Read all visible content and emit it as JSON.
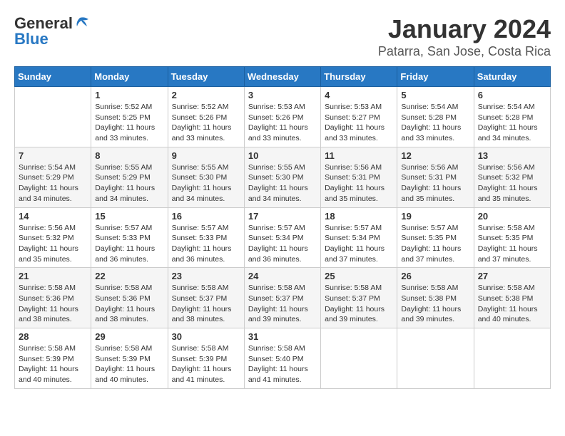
{
  "logo": {
    "line1": "General",
    "line2": "Blue"
  },
  "title": "January 2024",
  "subtitle": "Patarra, San Jose, Costa Rica",
  "headers": [
    "Sunday",
    "Monday",
    "Tuesday",
    "Wednesday",
    "Thursday",
    "Friday",
    "Saturday"
  ],
  "weeks": [
    [
      {
        "num": "",
        "info": ""
      },
      {
        "num": "1",
        "info": "Sunrise: 5:52 AM\nSunset: 5:25 PM\nDaylight: 11 hours\nand 33 minutes."
      },
      {
        "num": "2",
        "info": "Sunrise: 5:52 AM\nSunset: 5:26 PM\nDaylight: 11 hours\nand 33 minutes."
      },
      {
        "num": "3",
        "info": "Sunrise: 5:53 AM\nSunset: 5:26 PM\nDaylight: 11 hours\nand 33 minutes."
      },
      {
        "num": "4",
        "info": "Sunrise: 5:53 AM\nSunset: 5:27 PM\nDaylight: 11 hours\nand 33 minutes."
      },
      {
        "num": "5",
        "info": "Sunrise: 5:54 AM\nSunset: 5:28 PM\nDaylight: 11 hours\nand 33 minutes."
      },
      {
        "num": "6",
        "info": "Sunrise: 5:54 AM\nSunset: 5:28 PM\nDaylight: 11 hours\nand 34 minutes."
      }
    ],
    [
      {
        "num": "7",
        "info": "Sunrise: 5:54 AM\nSunset: 5:29 PM\nDaylight: 11 hours\nand 34 minutes."
      },
      {
        "num": "8",
        "info": "Sunrise: 5:55 AM\nSunset: 5:29 PM\nDaylight: 11 hours\nand 34 minutes."
      },
      {
        "num": "9",
        "info": "Sunrise: 5:55 AM\nSunset: 5:30 PM\nDaylight: 11 hours\nand 34 minutes."
      },
      {
        "num": "10",
        "info": "Sunrise: 5:55 AM\nSunset: 5:30 PM\nDaylight: 11 hours\nand 34 minutes."
      },
      {
        "num": "11",
        "info": "Sunrise: 5:56 AM\nSunset: 5:31 PM\nDaylight: 11 hours\nand 35 minutes."
      },
      {
        "num": "12",
        "info": "Sunrise: 5:56 AM\nSunset: 5:31 PM\nDaylight: 11 hours\nand 35 minutes."
      },
      {
        "num": "13",
        "info": "Sunrise: 5:56 AM\nSunset: 5:32 PM\nDaylight: 11 hours\nand 35 minutes."
      }
    ],
    [
      {
        "num": "14",
        "info": "Sunrise: 5:56 AM\nSunset: 5:32 PM\nDaylight: 11 hours\nand 35 minutes."
      },
      {
        "num": "15",
        "info": "Sunrise: 5:57 AM\nSunset: 5:33 PM\nDaylight: 11 hours\nand 36 minutes."
      },
      {
        "num": "16",
        "info": "Sunrise: 5:57 AM\nSunset: 5:33 PM\nDaylight: 11 hours\nand 36 minutes."
      },
      {
        "num": "17",
        "info": "Sunrise: 5:57 AM\nSunset: 5:34 PM\nDaylight: 11 hours\nand 36 minutes."
      },
      {
        "num": "18",
        "info": "Sunrise: 5:57 AM\nSunset: 5:34 PM\nDaylight: 11 hours\nand 37 minutes."
      },
      {
        "num": "19",
        "info": "Sunrise: 5:57 AM\nSunset: 5:35 PM\nDaylight: 11 hours\nand 37 minutes."
      },
      {
        "num": "20",
        "info": "Sunrise: 5:58 AM\nSunset: 5:35 PM\nDaylight: 11 hours\nand 37 minutes."
      }
    ],
    [
      {
        "num": "21",
        "info": "Sunrise: 5:58 AM\nSunset: 5:36 PM\nDaylight: 11 hours\nand 38 minutes."
      },
      {
        "num": "22",
        "info": "Sunrise: 5:58 AM\nSunset: 5:36 PM\nDaylight: 11 hours\nand 38 minutes."
      },
      {
        "num": "23",
        "info": "Sunrise: 5:58 AM\nSunset: 5:37 PM\nDaylight: 11 hours\nand 38 minutes."
      },
      {
        "num": "24",
        "info": "Sunrise: 5:58 AM\nSunset: 5:37 PM\nDaylight: 11 hours\nand 39 minutes."
      },
      {
        "num": "25",
        "info": "Sunrise: 5:58 AM\nSunset: 5:37 PM\nDaylight: 11 hours\nand 39 minutes."
      },
      {
        "num": "26",
        "info": "Sunrise: 5:58 AM\nSunset: 5:38 PM\nDaylight: 11 hours\nand 39 minutes."
      },
      {
        "num": "27",
        "info": "Sunrise: 5:58 AM\nSunset: 5:38 PM\nDaylight: 11 hours\nand 40 minutes."
      }
    ],
    [
      {
        "num": "28",
        "info": "Sunrise: 5:58 AM\nSunset: 5:39 PM\nDaylight: 11 hours\nand 40 minutes."
      },
      {
        "num": "29",
        "info": "Sunrise: 5:58 AM\nSunset: 5:39 PM\nDaylight: 11 hours\nand 40 minutes."
      },
      {
        "num": "30",
        "info": "Sunrise: 5:58 AM\nSunset: 5:39 PM\nDaylight: 11 hours\nand 41 minutes."
      },
      {
        "num": "31",
        "info": "Sunrise: 5:58 AM\nSunset: 5:40 PM\nDaylight: 11 hours\nand 41 minutes."
      },
      {
        "num": "",
        "info": ""
      },
      {
        "num": "",
        "info": ""
      },
      {
        "num": "",
        "info": ""
      }
    ]
  ]
}
